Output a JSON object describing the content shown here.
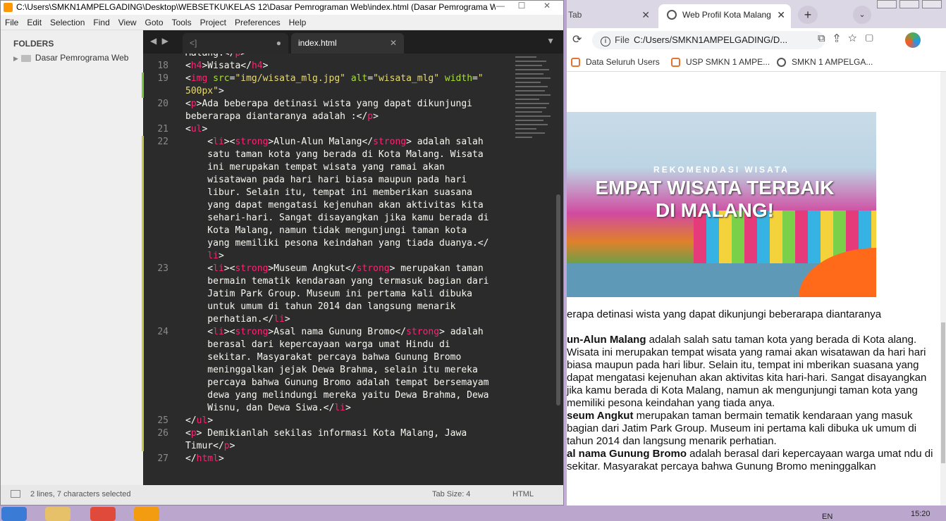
{
  "sublime": {
    "title": "C:\\Users\\SMKN1AMPELGADING\\Desktop\\WEBSETKU\\KELAS 12\\Dasar Pemrograman Web\\index.html (Dasar Pemrograma W...",
    "window_buttons": {
      "minimize": "—",
      "maximize": "☐",
      "close": "✕"
    },
    "menu": [
      "File",
      "Edit",
      "Selection",
      "Find",
      "View",
      "Goto",
      "Tools",
      "Project",
      "Preferences",
      "Help"
    ],
    "sidebar": {
      "header": "FOLDERS",
      "folder": "Dasar Pemrograma Web"
    },
    "tabs": {
      "nav": "◀ ▶",
      "tab1": "<]",
      "tab1_close": "●",
      "tab2": "index.html",
      "tab2_close": "✕",
      "more": "▼"
    },
    "status": {
      "selection": "2 lines, 7 characters selected",
      "tab_size": "Tab Size: 4",
      "syntax": "HTML"
    }
  },
  "chrome": {
    "tabs": {
      "tab1": "Tab",
      "tab2": "Web Profil Kota Malang",
      "close": "✕",
      "new_tab": "+",
      "dropdown": "⌄"
    },
    "address": {
      "scheme": "File",
      "url": "C:/Users/SMKN1AMPELGADING/D...",
      "icons": "⧉⇪☆▢"
    },
    "bookmarks": [
      "Data Seluruh Users",
      "USP SMKN 1 AMPE...",
      "SMKN 1 AMPELGA..."
    ],
    "banner": {
      "recommend": "REKOMENDASI WISATA",
      "headline1": "EMPAT WISATA TERBAIK",
      "headline2": "DI MALANG!"
    },
    "content": {
      "intro": "erapa detinasi wista yang dapat dikunjungi beberarapa diantaranya",
      "li1_strong": "un-Alun Malang",
      "li1_text": " adalah salah satu taman kota yang berada di Kota alang. Wisata ini merupakan tempat wisata yang ramai akan wisatawan da hari hari biasa maupun pada hari libur. Selain itu, tempat ini mberikan suasana yang dapat mengatasi kejenuhan akan aktivitas kita hari-hari. Sangat disayangkan jika kamu berada di Kota Malang, namun ak mengunjungi taman kota yang memiliki pesona keindahan yang tiada anya.",
      "li2_strong": "seum Angkut",
      "li2_text": " merupakan taman bermain tematik kendaraan yang masuk bagian dari Jatim Park Group. Museum ini pertama kali dibuka uk umum di tahun 2014 dan langsung menarik perhatian.",
      "li3_strong": "al nama Gunung Bromo",
      "li3_text": " adalah berasal dari kepercayaan warga umat ndu di sekitar. Masyarakat percaya bahwa Gunung Bromo meninggalkan"
    }
  },
  "taskbar": {
    "lang": "EN",
    "time": "15:20"
  }
}
